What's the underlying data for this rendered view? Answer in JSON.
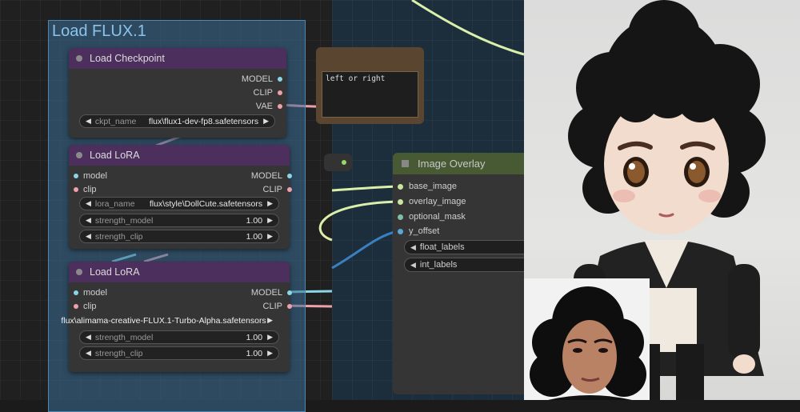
{
  "group": {
    "title": "Load FLUX.1"
  },
  "checkpoint": {
    "title": "Load Checkpoint",
    "outputs": [
      "MODEL",
      "CLIP",
      "VAE"
    ],
    "ckpt_label": "ckpt_name",
    "ckpt_value": "flux\\flux1-dev-fp8.safetensors"
  },
  "lora1": {
    "title": "Load LoRA",
    "inputs": [
      "model",
      "clip"
    ],
    "outputs": [
      "MODEL",
      "CLIP"
    ],
    "lora_label": "lora_name",
    "lora_value": "flux\\style\\DollCute.safetensors",
    "strength_model_label": "strength_model",
    "strength_model_value": "1.00",
    "strength_clip_label": "strength_clip",
    "strength_clip_value": "1.00"
  },
  "lora2": {
    "title": "Load LoRA",
    "inputs": [
      "model",
      "clip"
    ],
    "outputs": [
      "MODEL",
      "CLIP"
    ],
    "lora_value": "flux\\alimama-creative-FLUX.1-Turbo-Alpha.safetensors",
    "strength_model_label": "strength_model",
    "strength_model_value": "1.00",
    "strength_clip_label": "strength_clip",
    "strength_clip_value": "1.00"
  },
  "note": {
    "text": "left or right"
  },
  "image_overlay": {
    "title": "Image Overlay",
    "inputs": [
      "base_image",
      "overlay_image",
      "optional_mask",
      "y_offset"
    ],
    "widgets": [
      "float_labels",
      "int_labels"
    ]
  },
  "colors": {
    "model_socket": "#8ad6e6",
    "clip_socket": "#f0a0a8",
    "image_socket": "#c8e6a0",
    "mask_socket": "#7fbfaa",
    "int_socket": "#5aa6d8",
    "lora_header": "#4d2f5e",
    "overlay_header": "#485a33",
    "note_header": "#5a4630"
  }
}
